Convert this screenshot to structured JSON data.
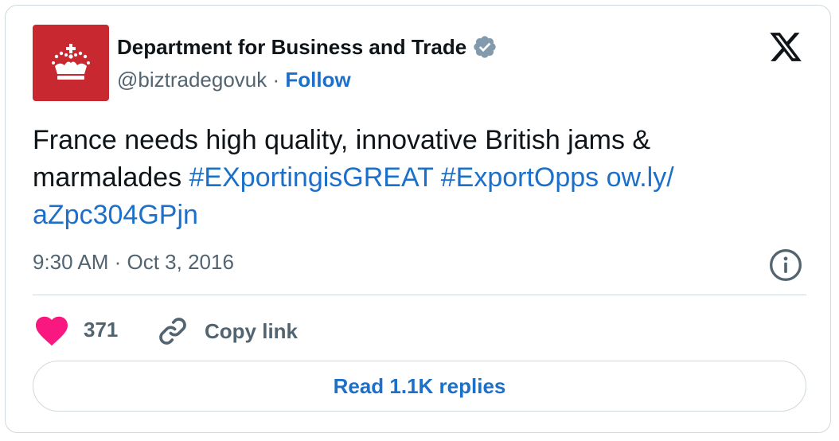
{
  "author": {
    "name": "Department for Business and Trade",
    "handle": "@biztradegovuk",
    "separator": " · ",
    "follow_label": "Follow"
  },
  "tweet": {
    "text_plain": "France needs high quality, innovative British jams & marmalades ",
    "hashtag_1": "#EXportingisGREAT",
    "hashtag_2": "#ExportOpps",
    "link_part_1": "ow.ly/",
    "link_part_2": "aZpc304GPjn",
    "timestamp": "9:30 AM · Oct 3, 2016"
  },
  "actions": {
    "like_count": "371",
    "copy_link_label": "Copy link",
    "read_replies_label": "Read 1.1K replies"
  },
  "icons": {
    "avatar": "crown-logo-icon",
    "verified": "verified-badge-icon",
    "platform": "x-logo-icon",
    "info": "info-icon",
    "like": "heart-icon",
    "copy": "link-icon"
  },
  "colors": {
    "accent_blue": "#1d70c9",
    "like_pink": "#f91880",
    "avatar_red": "#c8282f",
    "muted_text": "#536471",
    "border": "#cfd9de"
  }
}
